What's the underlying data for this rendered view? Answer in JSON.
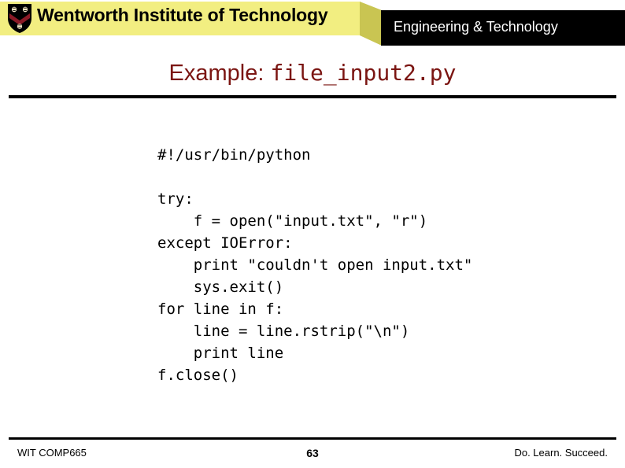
{
  "header": {
    "institution_name": "Wentworth Institute of Technology",
    "department_name": "Engineering & Technology",
    "logo_icon": "wentworth-crest-icon",
    "yellow_color": "#F2EE81",
    "bevel_color": "#C9C552",
    "black_color": "#000000"
  },
  "slide": {
    "title_prefix": "Example: ",
    "title_filename": "file_input2.py",
    "title_color": "#7B1512",
    "code_lines": [
      "#!/usr/bin/python",
      "",
      "try:",
      "    f = open(\"input.txt\", \"r\")",
      "except IOError:",
      "    print \"couldn't open input.txt\"",
      "    sys.exit()",
      "for line in f:",
      "    line = line.rstrip(\"\\n\")",
      "    print line",
      "f.close()"
    ]
  },
  "footer": {
    "course": "WIT COMP665",
    "page_number": "63",
    "tagline": "Do. Learn. Succeed."
  }
}
